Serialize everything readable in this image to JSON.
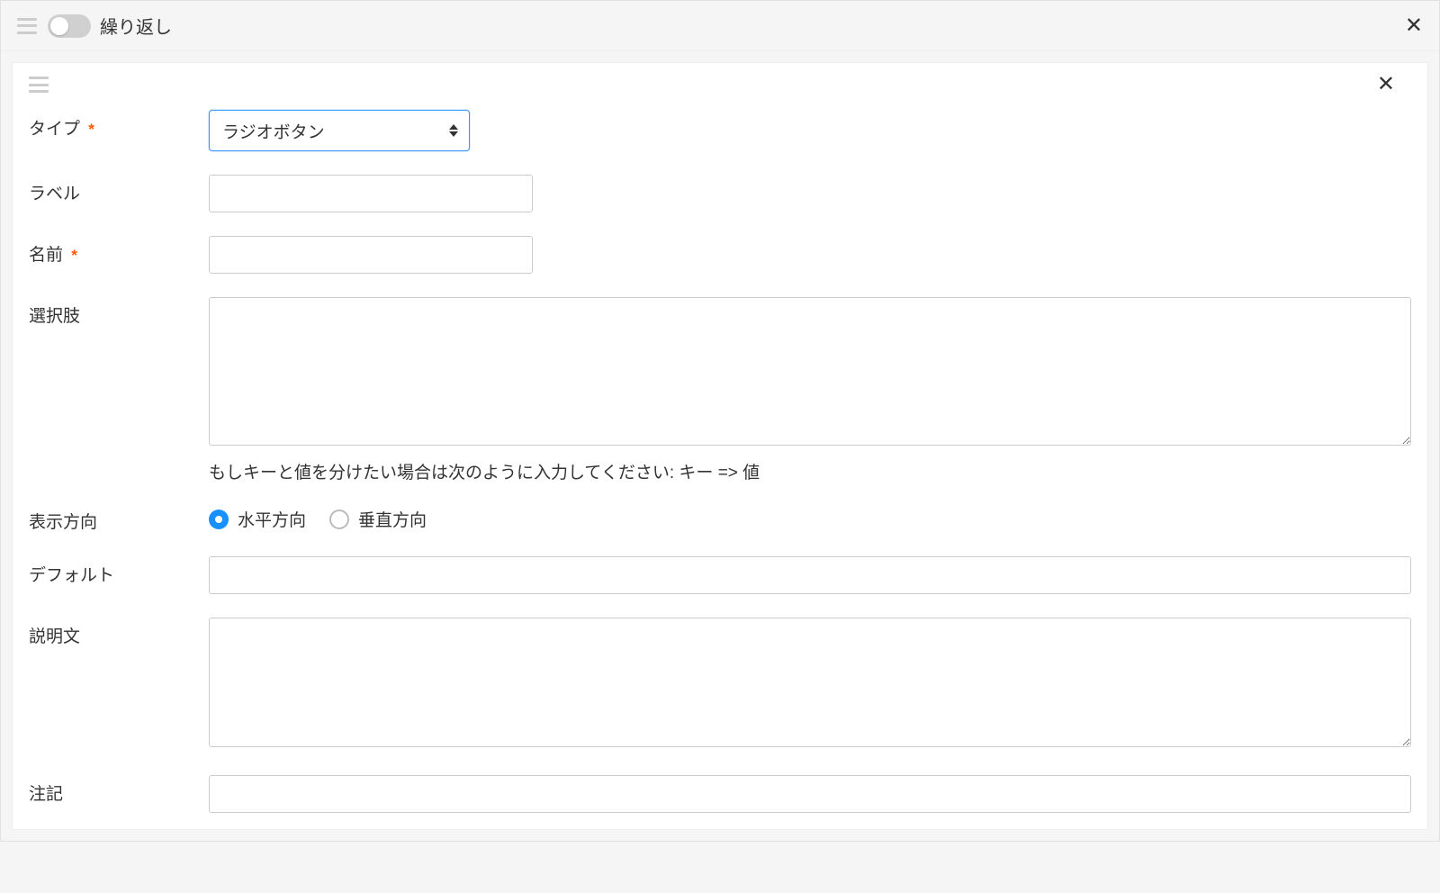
{
  "outer": {
    "repeat_label": "繰り返し"
  },
  "form": {
    "type": {
      "label": "タイプ",
      "selected": "ラジオボタン"
    },
    "field_label": {
      "label": "ラベル",
      "value": ""
    },
    "name": {
      "label": "名前",
      "value": ""
    },
    "choices": {
      "label": "選択肢",
      "value": "",
      "help": "もしキーと値を分けたい場合は次のように入力してください: キー => 値"
    },
    "direction": {
      "label": "表示方向",
      "options": {
        "horizontal": "水平方向",
        "vertical": "垂直方向"
      },
      "selected": "horizontal"
    },
    "default": {
      "label": "デフォルト",
      "value": ""
    },
    "description": {
      "label": "説明文",
      "value": ""
    },
    "note": {
      "label": "注記",
      "value": ""
    }
  }
}
